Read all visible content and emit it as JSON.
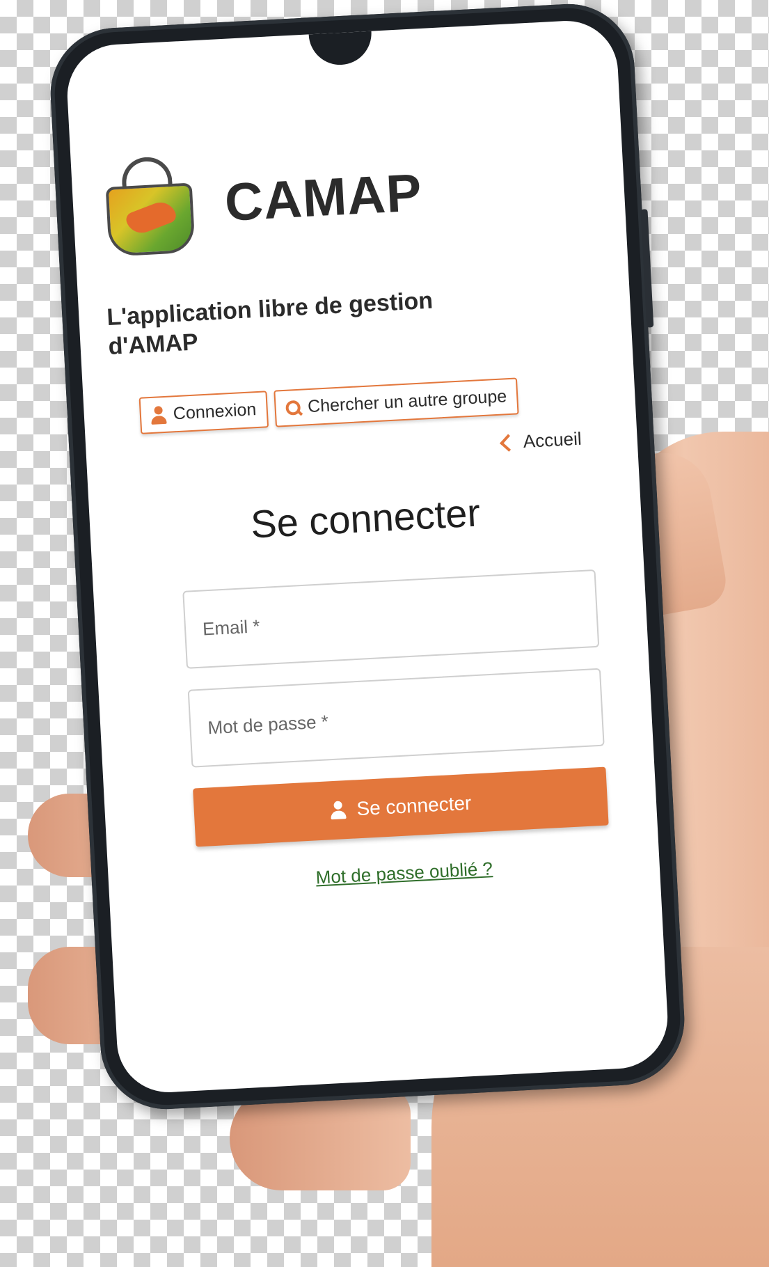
{
  "app": {
    "title": "CAMAP",
    "tagline": "L'application libre de gestion d'AMAP"
  },
  "nav": {
    "login_label": "Connexion",
    "search_group_label": "Chercher un autre groupe",
    "back_label": "Accueil"
  },
  "login": {
    "heading": "Se connecter",
    "email_placeholder": "Email *",
    "password_placeholder": "Mot de passe *",
    "submit_label": "Se connecter",
    "forgot_label": "Mot de passe oublié ?"
  },
  "colors": {
    "accent": "#e3773c",
    "link": "#2f6e2a",
    "text": "#2b2b2b"
  },
  "icons": [
    "user-icon",
    "search-icon",
    "chevron-left-icon",
    "basket-logo"
  ]
}
